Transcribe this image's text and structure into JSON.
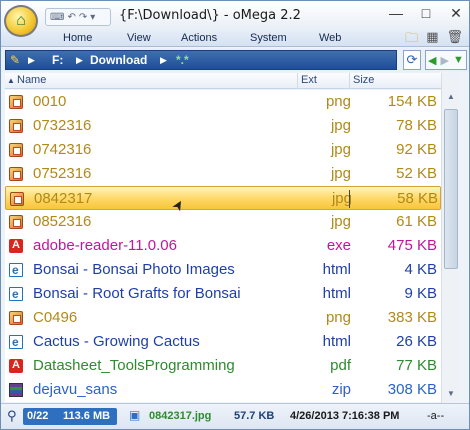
{
  "window": {
    "title": "{F:\\Download\\} - oMega 2.2",
    "controls": {
      "minimize": "—",
      "maximize": "□",
      "close": "✕"
    }
  },
  "menu": [
    "Home",
    "View",
    "Actions",
    "System",
    "Web"
  ],
  "address": {
    "drive": "F:",
    "folder": "Download",
    "filter": "*.*"
  },
  "columns": {
    "name": "Name",
    "ext": "Ext",
    "size": "Size"
  },
  "files": [
    {
      "name": "0010",
      "ext": "png",
      "size": "154 KB",
      "type": "image",
      "color": "#b08a17"
    },
    {
      "name": "0732316",
      "ext": "jpg",
      "size": "78 KB",
      "type": "image",
      "color": "#b08a17"
    },
    {
      "name": "0742316",
      "ext": "jpg",
      "size": "92 KB",
      "type": "image",
      "color": "#b08a17"
    },
    {
      "name": "0752316",
      "ext": "jpg",
      "size": "52 KB",
      "type": "image",
      "color": "#b08a17"
    },
    {
      "name": "0842317",
      "ext": "jpg",
      "size": "58 KB",
      "type": "image",
      "color": "#b08a17",
      "selected": true
    },
    {
      "name": "0852316",
      "ext": "jpg",
      "size": "61 KB",
      "type": "image",
      "color": "#b08a17"
    },
    {
      "name": "adobe-reader-11.0.06",
      "ext": "exe",
      "size": "475 KB",
      "type": "pdf",
      "color": "#c0169c"
    },
    {
      "name": "Bonsai - Bonsai Photo Images",
      "ext": "html",
      "size": "4 KB",
      "type": "web",
      "color": "#1f3fa8"
    },
    {
      "name": "Bonsai - Root Grafts for Bonsai",
      "ext": "html",
      "size": "9 KB",
      "type": "web",
      "color": "#1f3fa8"
    },
    {
      "name": "C0496",
      "ext": "png",
      "size": "383 KB",
      "type": "image",
      "color": "#b08a17"
    },
    {
      "name": "Cactus - Growing Cactus",
      "ext": "html",
      "size": "26 KB",
      "type": "web",
      "color": "#1f3fa8"
    },
    {
      "name": "Datasheet_ToolsProgramming",
      "ext": "pdf",
      "size": "77 KB",
      "type": "pdf",
      "color": "#2e8b2e"
    },
    {
      "name": "dejavu_sans",
      "ext": "zip",
      "size": "308 KB",
      "type": "zip",
      "color": "#2a63c8"
    }
  ],
  "status": {
    "selection": "0/22",
    "total_size": "113.6 MB",
    "current_file": "0842317.jpg",
    "file_size": "57.7 KB",
    "modified": "4/26/2013 7:16:38 PM",
    "attributes": "-a--"
  }
}
